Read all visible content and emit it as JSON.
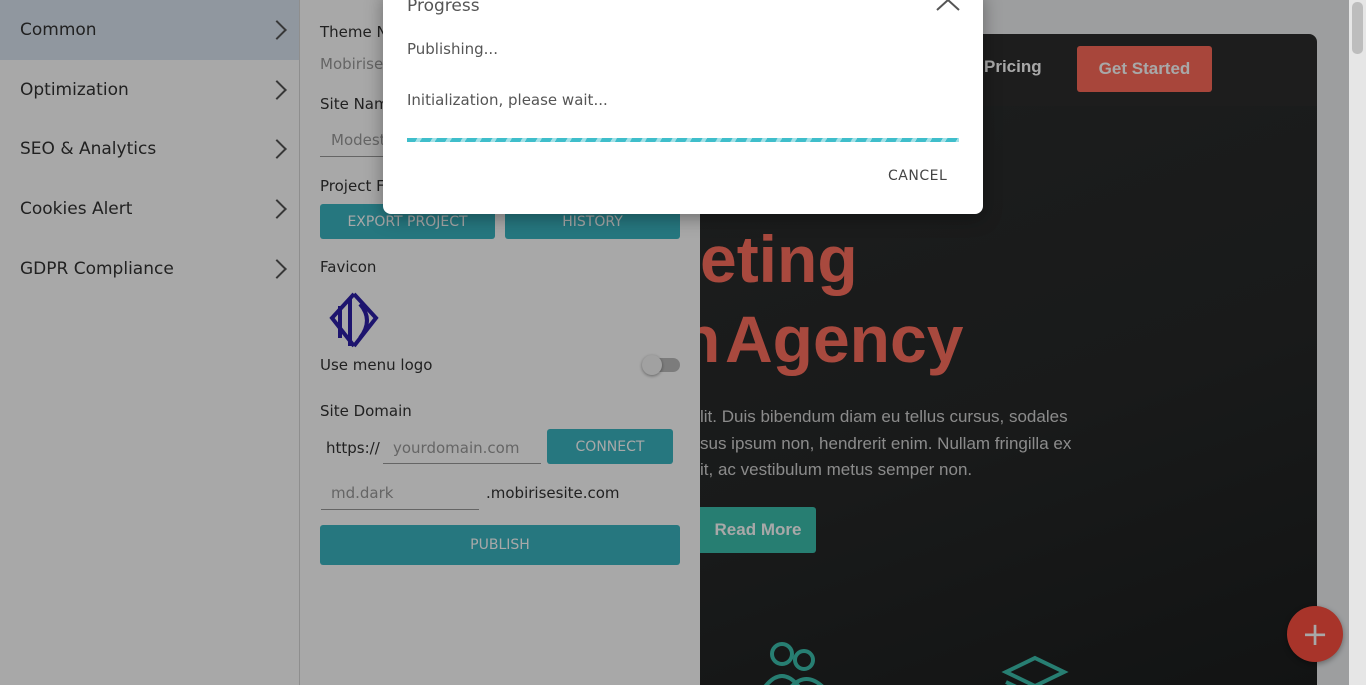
{
  "sidebar": {
    "items": [
      {
        "label": "Common"
      },
      {
        "label": "Optimization"
      },
      {
        "label": "SEO & Analytics"
      },
      {
        "label": "Cookies Alert"
      },
      {
        "label": "GDPR Compliance"
      }
    ]
  },
  "panel": {
    "theme_label": "Theme N",
    "theme_value": "Mobirise",
    "site_name_label": "Site Nam",
    "site_name_value": "Modest",
    "project_files_label": "Project Fi",
    "export_button": "EXPORT PROJECT",
    "history_button": "HISTORY",
    "favicon_label": "Favicon",
    "use_menu_logo_label": "Use menu logo",
    "use_menu_logo_on": false,
    "site_domain_label": "Site Domain",
    "https_prefix": "https://",
    "domain_placeholder": "yourdomain.com",
    "connect_button": "CONNECT",
    "subdomain_value": "md.dark",
    "subdomain_suffix": ".mobirisesite.com",
    "publish_button": "PUBLISH"
  },
  "preview": {
    "nav_pricing": "Pricing",
    "nav_cta": "Get Started",
    "hero_line1": "eting",
    "hero_line2": "Agency",
    "hero_body": [
      "lit. Duis bibendum diam eu tellus cursus, sodales",
      "sus ipsum non, hendrerit enim. Nullam fringilla ex",
      "it, ac vestibulum metus semper non."
    ],
    "read_more": "Read More",
    "fab_symbol": "+"
  },
  "dialog": {
    "title": "Progress",
    "status": "Publishing...",
    "message": "Initialization, please wait...",
    "cancel": "CANCEL"
  },
  "colors": {
    "sidebar_active": "#dbe5f1",
    "teal": "#3ab5c1",
    "coral": "#ff6f5e",
    "favicon": "#2c1fa8"
  },
  "icons": [
    "chevron-right-icon",
    "close-icon",
    "favicon-logo-icon",
    "people-icon",
    "stack-icon",
    "plus-icon"
  ]
}
